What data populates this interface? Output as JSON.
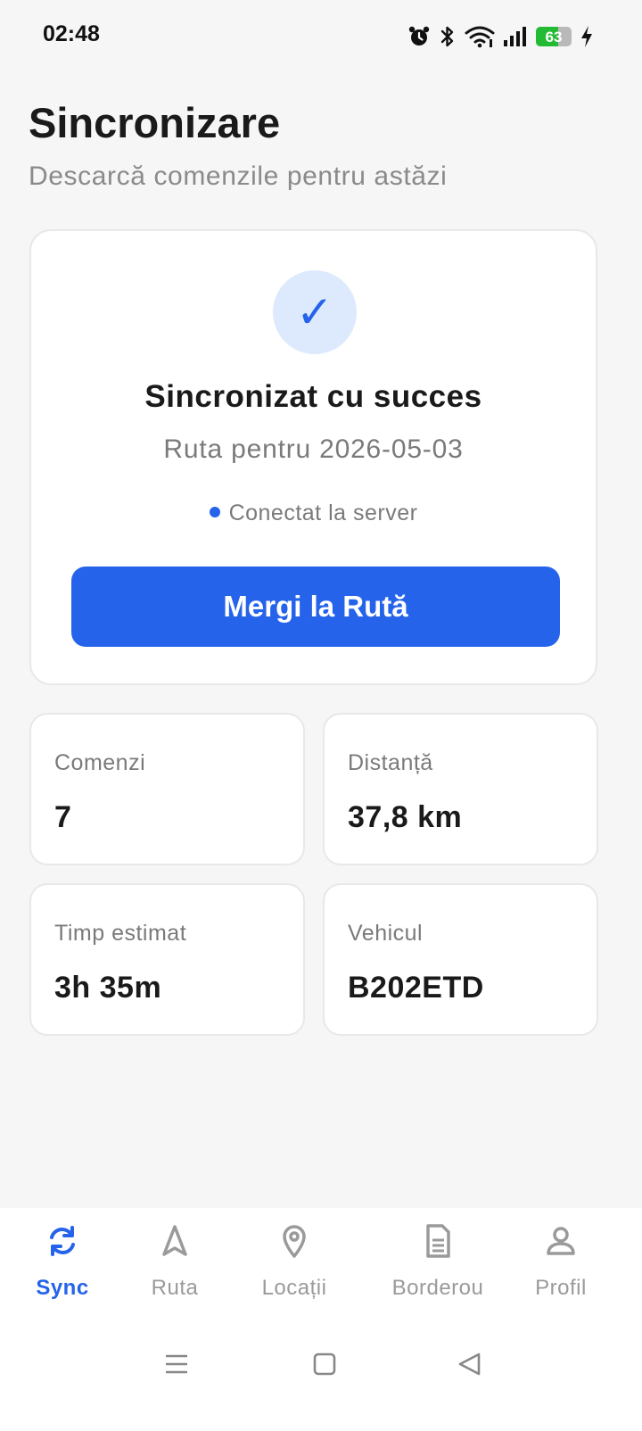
{
  "status_bar": {
    "time": "02:48",
    "battery_level": "63",
    "battery_percent": 63,
    "icons": [
      "alarm-icon",
      "bluetooth-icon",
      "wifi-icon",
      "signal-icon",
      "battery-icon",
      "charging-icon"
    ]
  },
  "header": {
    "title": "Sincronizare",
    "subtitle": "Descarcă comenzile pentru astăzi"
  },
  "sync_card": {
    "check_glyph": "✓",
    "status": "Sincronizat cu succes",
    "route_label": "Ruta pentru 2026-05-03",
    "connection_status": "Conectat la server",
    "button_label": "Mergi la Rută"
  },
  "stats": [
    {
      "label": "Comenzi",
      "value": "7"
    },
    {
      "label": "Distanță",
      "value": "37,8 km"
    },
    {
      "label": "Timp estimat",
      "value": "3h 35m"
    },
    {
      "label": "Vehicul",
      "value": "B202ETD"
    }
  ],
  "bottom_nav": {
    "items": [
      {
        "label": "Sync",
        "icon": "sync-icon",
        "active": true
      },
      {
        "label": "Ruta",
        "icon": "navigation-icon",
        "active": false
      },
      {
        "label": "Locații",
        "icon": "location-pin-icon",
        "active": false
      },
      {
        "label": "Borderou",
        "icon": "document-icon",
        "active": false
      },
      {
        "label": "Profil",
        "icon": "user-icon",
        "active": false
      }
    ]
  },
  "colors": {
    "accent": "#2563eb",
    "accent_light": "#dde9fd",
    "background": "#f6f6f6",
    "card": "#ffffff",
    "muted_text": "#7a7a7a",
    "battery_green": "#22bb33"
  }
}
